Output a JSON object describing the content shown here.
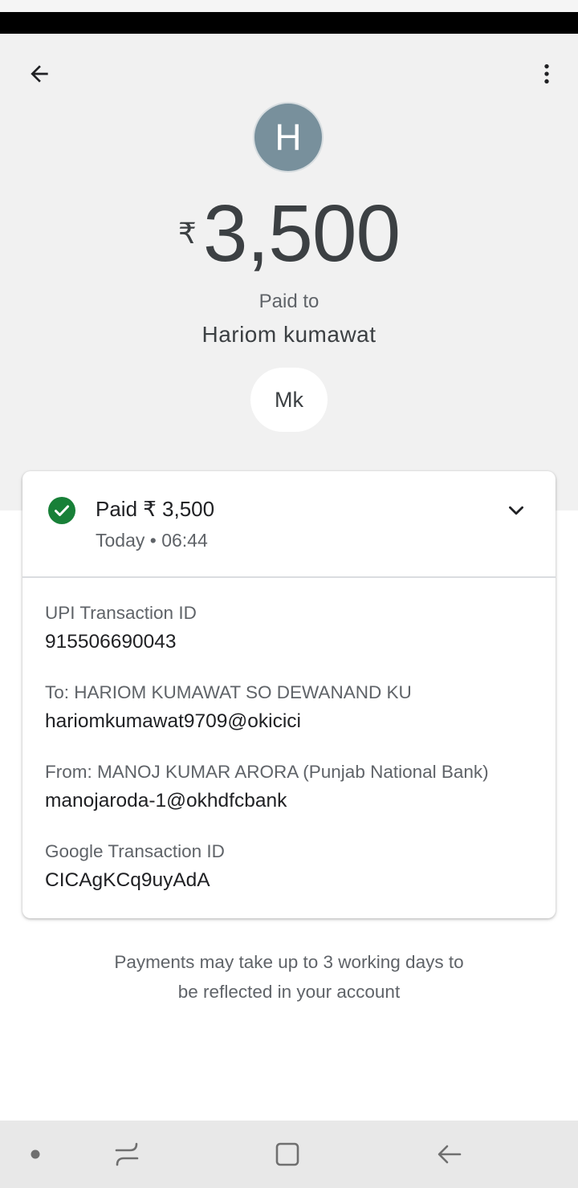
{
  "header": {
    "back_icon": "arrow-left-icon",
    "more_icon": "more-vertical-icon"
  },
  "payee": {
    "avatar_initial": "H",
    "name": "Hariom kumawat",
    "avatar_color": "#78909c"
  },
  "payment": {
    "currency_symbol": "₹",
    "amount": "3,500",
    "paid_to_label": "Paid to",
    "note": "Mk"
  },
  "status_card": {
    "title": "Paid ₹ 3,500",
    "time": "Today • 06:44",
    "status_icon": "check-circle-icon",
    "status_color": "#188038",
    "toggle_icon": "chevron-down-icon"
  },
  "details": [
    {
      "label": "UPI Transaction ID",
      "value": "915506690043"
    },
    {
      "label": "To: HARIOM KUMAWAT SO DEWANAND KU",
      "value": "hariomkumawat9709@okicici"
    },
    {
      "label": "From: MANOJ KUMAR ARORA (Punjab National Bank)",
      "value": "manojaroda-1@okhdfcbank"
    },
    {
      "label": "Google Transaction ID",
      "value": "CICAgKCq9uyAdA"
    }
  ],
  "footer": {
    "line1": "Payments may take up to 3 working days to",
    "line2": "be reflected in your account"
  },
  "nav": {
    "items": [
      "dot-icon",
      "recents-icon",
      "home-icon",
      "back-icon"
    ]
  }
}
